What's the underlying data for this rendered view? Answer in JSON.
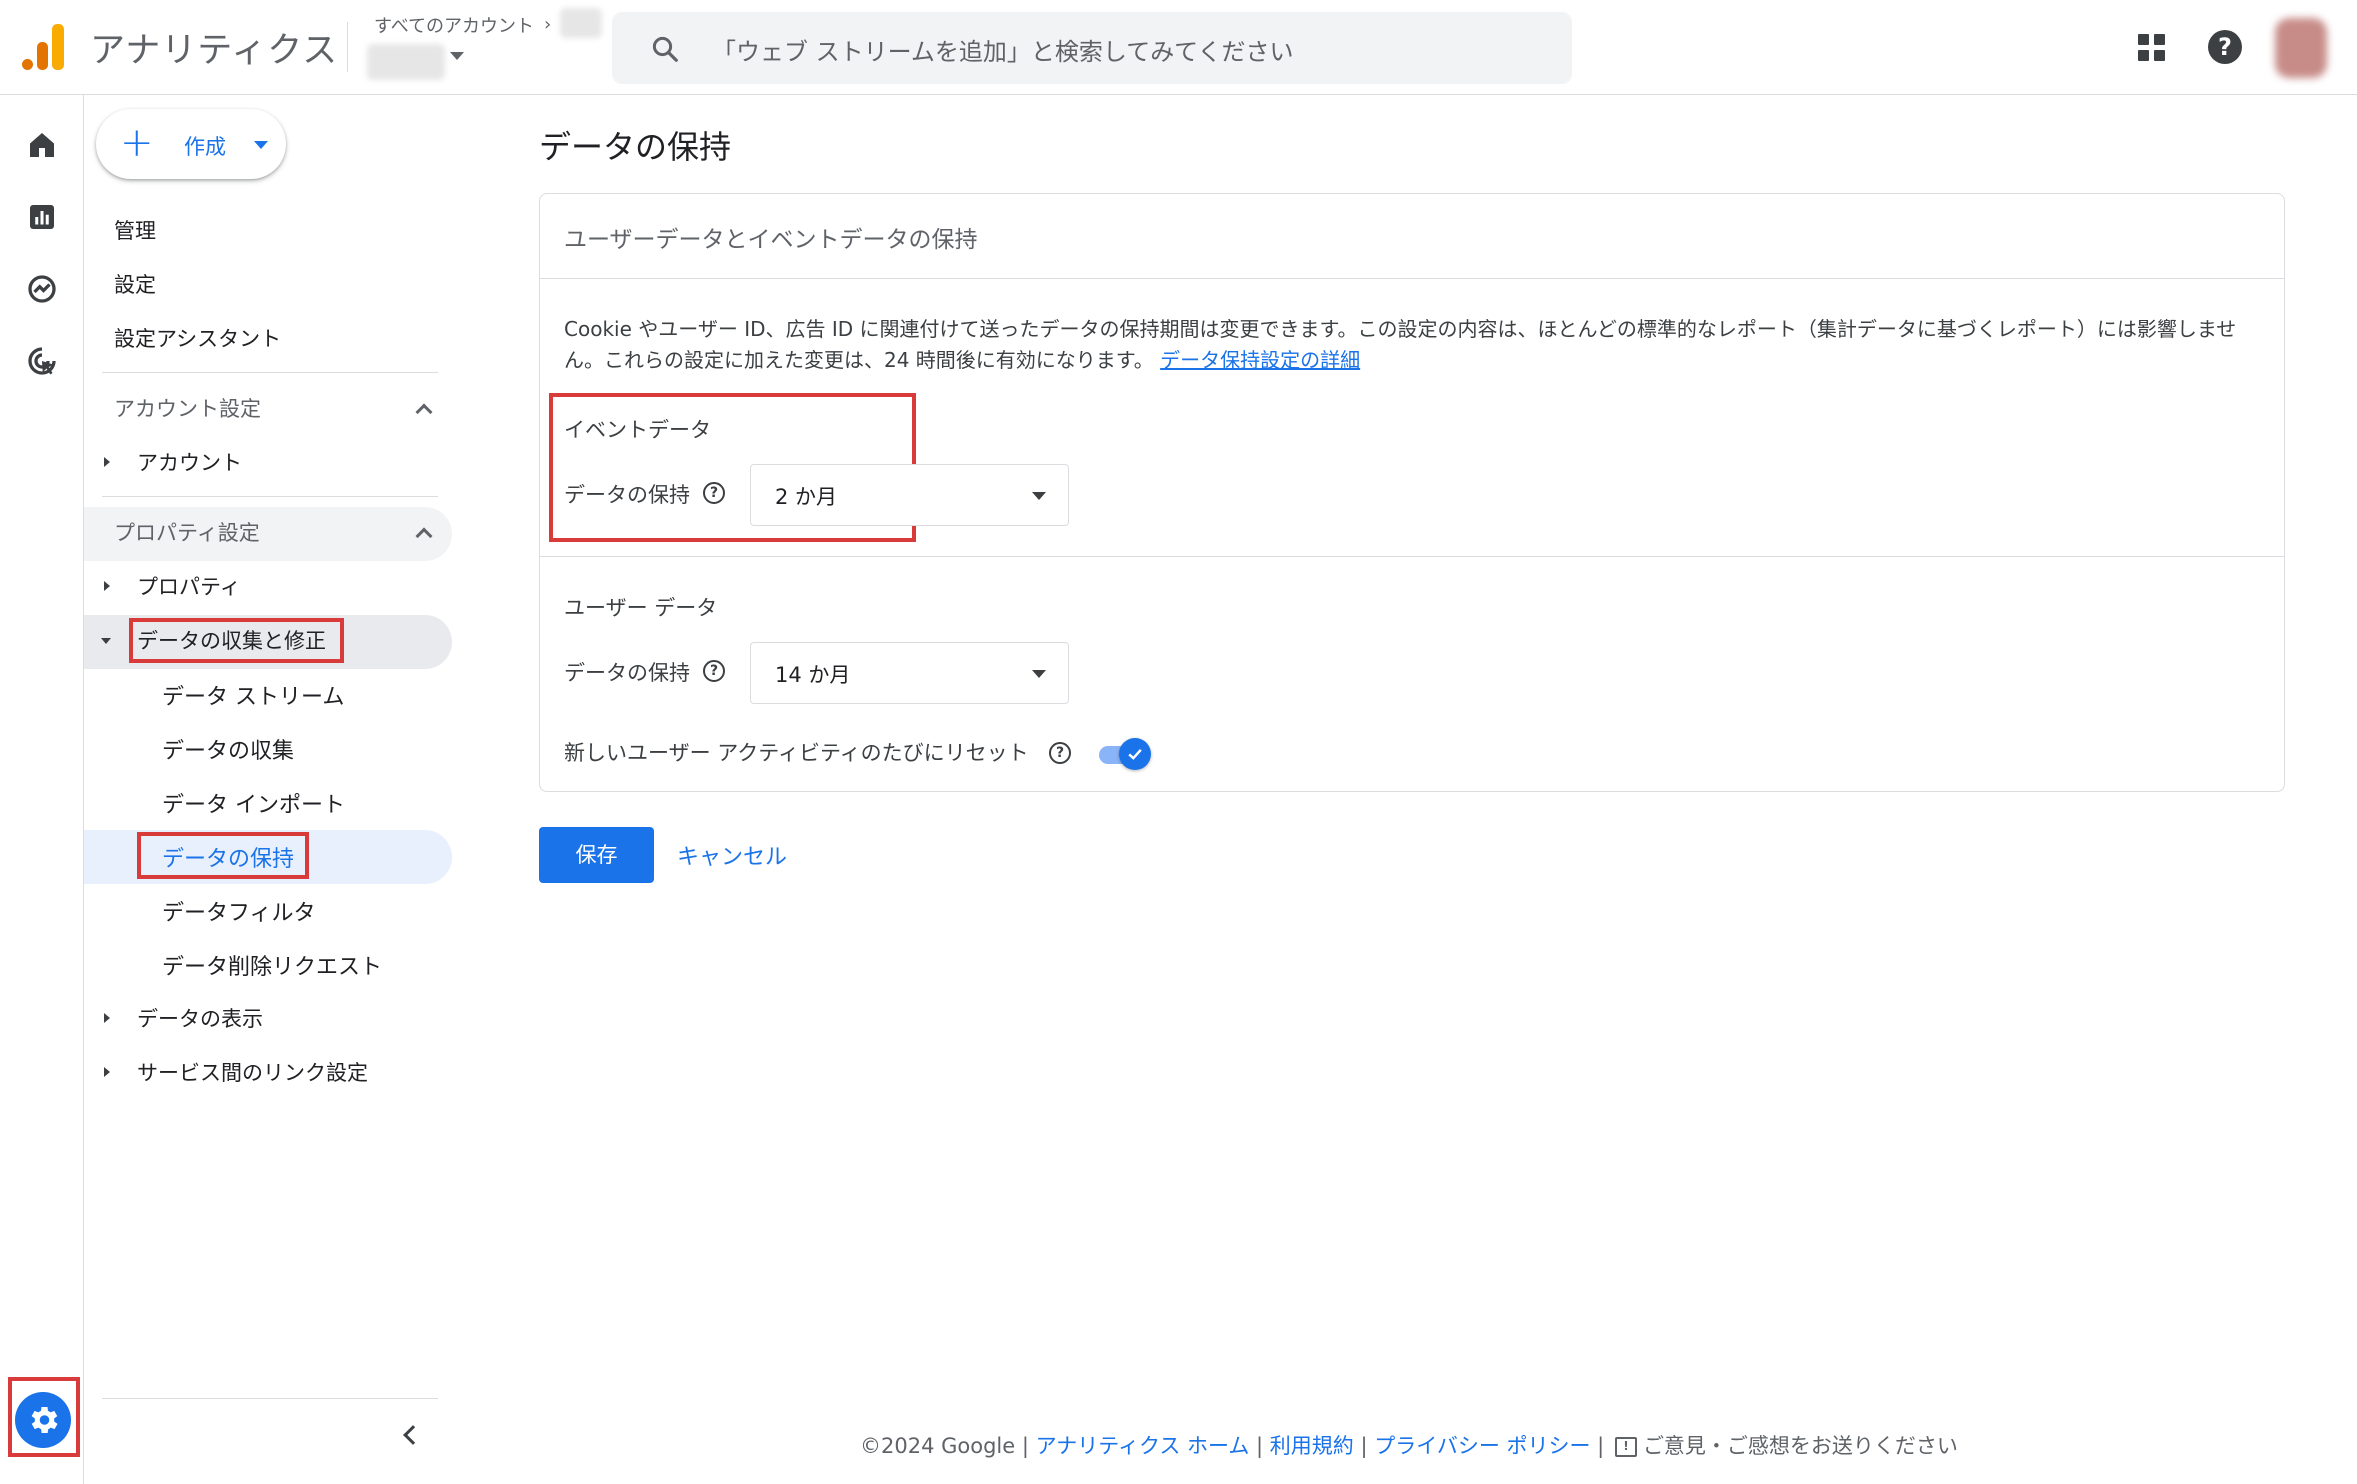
{
  "header": {
    "app_name": "アナリティクス",
    "all_accounts": "すべてのアカウント",
    "search_placeholder": "「ウェブ ストリームを追加」と検索してみてください"
  },
  "create_button": {
    "label": "作成"
  },
  "nav": {
    "admin": "管理",
    "settings": "設定",
    "setup_assistant": "設定アシスタント",
    "account_settings_header": "アカウント設定",
    "account": "アカウント",
    "property_settings_header": "プロパティ設定",
    "property": "プロパティ",
    "data_collection_modification": "データの収集と修正",
    "sub_items": [
      "データ ストリーム",
      "データの収集",
      "データ インポート",
      "データの保持",
      "データフィルタ",
      "データ削除リクエスト"
    ],
    "data_display": "データの表示",
    "product_links": "サービス間のリンク設定"
  },
  "main": {
    "page_title": "データの保持",
    "card_title": "ユーザーデータとイベントデータの保持",
    "description": "Cookie やユーザー ID、広告 ID に関連付けて送ったデータの保持期間は変更できます。この設定の内容は、ほとんどの標準的なレポート（集計データに基づくレポート）には影響しません。これらの設定に加えた変更は、24 時間後に有効になります。",
    "description_link": "データ保持設定の詳細",
    "event_data": {
      "label": "イベントデータ",
      "field_label": "データの保持",
      "value": "2 か月"
    },
    "user_data": {
      "label": "ユーザー データ",
      "field_label": "データの保持",
      "value": "14 か月",
      "reset_label": "新しいユーザー アクティビティのたびにリセット",
      "reset_enabled": true
    },
    "save": "保存",
    "cancel": "キャンセル"
  },
  "footer": {
    "copyright": "©2024 Google",
    "analytics_home": "アナリティクス ホーム",
    "terms": "利用規約",
    "privacy": "プライバシー ポリシー",
    "feedback": "ご意見・ご感想をお送りください"
  },
  "colors": {
    "accent": "#1a73e8",
    "highlight_box": "#d93b3b",
    "nav_selected_bg": "#e8f0fe",
    "nav_active_bg": "#e8eaed"
  }
}
